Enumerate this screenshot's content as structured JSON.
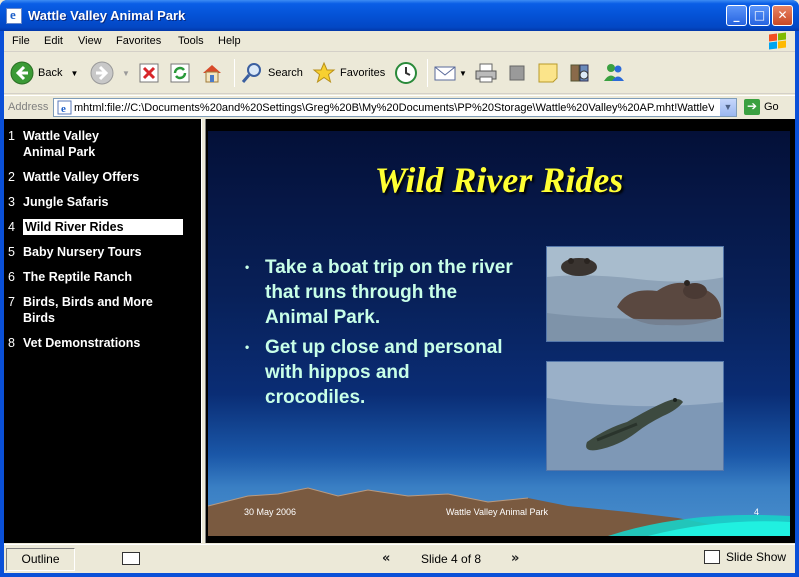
{
  "window": {
    "title": "Wattle Valley Animal Park"
  },
  "menu": {
    "items": [
      "File",
      "Edit",
      "View",
      "Favorites",
      "Tools",
      "Help"
    ]
  },
  "toolbar": {
    "back_label": "Back",
    "search_label": "Search",
    "favorites_label": "Favorites"
  },
  "address": {
    "label": "Address",
    "value": "mhtml:file://C:\\Documents%20and%20Settings\\Greg%20B\\My%20Documents\\PP%20Storage\\Wattle%20Valley%20AP.mht!WattleV...",
    "go_label": "Go"
  },
  "outline": {
    "items": [
      {
        "num": "1",
        "label": "Wattle Valley Animal Park"
      },
      {
        "num": "2",
        "label": "Wattle Valley Offers"
      },
      {
        "num": "3",
        "label": "Jungle Safaris"
      },
      {
        "num": "4",
        "label": "Wild River Rides",
        "active": true
      },
      {
        "num": "5",
        "label": "Baby Nursery Tours"
      },
      {
        "num": "6",
        "label": "The Reptile Ranch"
      },
      {
        "num": "7",
        "label": "Birds, Birds and More Birds"
      },
      {
        "num": "8",
        "label": "Vet Demonstrations"
      }
    ]
  },
  "slide": {
    "title": "Wild River Rides",
    "bullets": [
      "Take a boat trip on the river that runs through the Animal Park.",
      "Get up close and personal with hippos and crocodiles."
    ],
    "footer_date": "30 May 2006",
    "footer_title": "Wattle Valley Animal Park",
    "footer_number": "4"
  },
  "status": {
    "outline_label": "Outline",
    "slide_counter": "Slide 4 of 8",
    "slideshow_label": "Slide Show"
  },
  "colors": {
    "title_bar": "#0452d6",
    "slide_title": "#ffff33",
    "bullet_text": "#c8ffe8",
    "outline_bg": "#000000"
  }
}
